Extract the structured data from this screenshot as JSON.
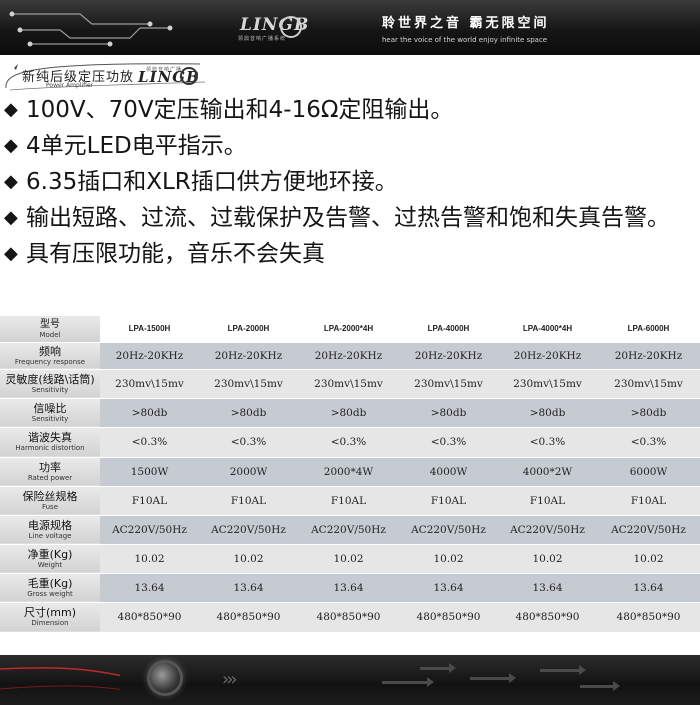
{
  "header": {
    "brand_logo_text": "LINGB",
    "brand_logo_sub": "领鼎音响广播系统",
    "slogan_cn": "聆世界之音  霸无限空间",
    "slogan_en": "hear the voice of the world  enjoy infinite space"
  },
  "product": {
    "title_cn": "新纯后级定压功放",
    "title_en": "Power Amplifier",
    "logo_text": "LINGB",
    "logo_sub": "领鼎音响广播"
  },
  "features": [
    "100V、70V定压输出和4-16Ω定阻输出。",
    "4单元LED电平指示。",
    "6.35插口和XLR插口供方便地环接。",
    "输出短路、过流、过载保护及告警、过热告警和饱和失真告警。",
    "具有压限功能，音乐不会失真"
  ],
  "bullet_symbol": "◆",
  "spec_table": {
    "rows": [
      {
        "cn": "型号",
        "en": "Model",
        "values": [
          "LPA-1500H",
          "LPA-2000H",
          "LPA-2000*4H",
          "LPA-4000H",
          "LPA-4000*4H",
          "LPA-6000H"
        ]
      },
      {
        "cn": "频响",
        "en": "Frequency response",
        "values": [
          "20Hz-20KHz",
          "20Hz-20KHz",
          "20Hz-20KHz",
          "20Hz-20KHz",
          "20Hz-20KHz",
          "20Hz-20KHz"
        ]
      },
      {
        "cn": "灵敏度(线路\\话筒)",
        "en": "Sensitivity",
        "values": [
          "230mv\\15mv",
          "230mv\\15mv",
          "230mv\\15mv",
          "230mv\\15mv",
          "230mv\\15mv",
          "230mv\\15mv"
        ]
      },
      {
        "cn": "信噪比",
        "en": "Sensitivity",
        "values": [
          ">80db",
          ">80db",
          ">80db",
          ">80db",
          ">80db",
          ">80db"
        ]
      },
      {
        "cn": "谐波失真",
        "en": "Harmonic distortion",
        "values": [
          "<0.3%",
          "<0.3%",
          "<0.3%",
          "<0.3%",
          "<0.3%",
          "<0.3%"
        ]
      },
      {
        "cn": "功率",
        "en": "Rated power",
        "values": [
          "1500W",
          "2000W",
          "2000*4W",
          "4000W",
          "4000*2W",
          "6000W"
        ]
      },
      {
        "cn": "保险丝规格",
        "en": "Fuse",
        "values": [
          "F10AL",
          "F10AL",
          "F10AL",
          "F10AL",
          "F10AL",
          "F10AL"
        ]
      },
      {
        "cn": "电源规格",
        "en": "Line voltage",
        "values": [
          "AC220V/50Hz",
          "AC220V/50Hz",
          "AC220V/50Hz",
          "AC220V/50Hz",
          "AC220V/50Hz",
          "AC220V/50Hz"
        ]
      },
      {
        "cn": "净重(Kg)",
        "en": "Weight",
        "values": [
          "10.02",
          "10.02",
          "10.02",
          "10.02",
          "10.02",
          "10.02"
        ]
      },
      {
        "cn": "毛重(Kg)",
        "en": "Gross weight",
        "values": [
          "13.64",
          "13.64",
          "13.64",
          "13.64",
          "13.64",
          "13.64"
        ]
      },
      {
        "cn": "尺寸(mm)",
        "en": "Dimension",
        "values": [
          "480*850*90",
          "480*850*90",
          "480*850*90",
          "480*850*90",
          "480*850*90",
          "480*850*90"
        ]
      }
    ]
  },
  "footer": {
    "chevrons": "›››"
  },
  "colors": {
    "header_bg": "#161616",
    "row_light": "#e6e6e6",
    "row_blue": "#c6cbd2",
    "accent_red": "#c0282a"
  }
}
